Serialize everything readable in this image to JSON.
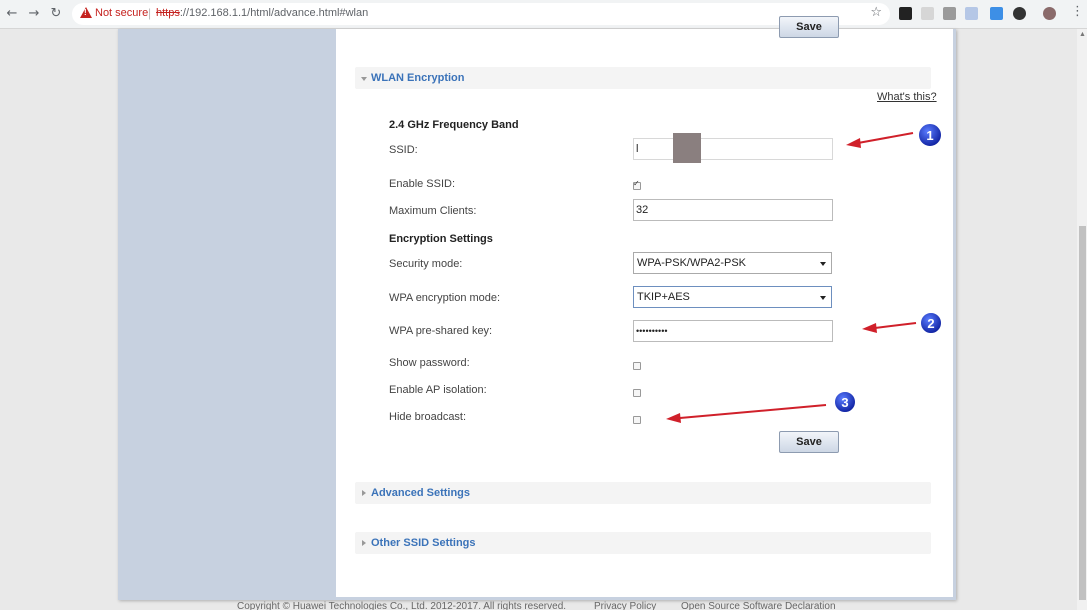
{
  "browser": {
    "back_icon": "arrow-left-icon",
    "forward_icon": "arrow-right-icon",
    "reload_icon": "reload-icon",
    "security_text": "Not secure",
    "url_protocol": "https",
    "url_rest": "://192.168.1.1/html/advance.html#wlan",
    "star_icon": "star-icon",
    "menu_icon": "kebab-menu-icon"
  },
  "top_save_label": "Save",
  "wlan_encryption": {
    "title": "WLAN Encryption",
    "help_link": "What's this?",
    "band_title": "2.4 GHz Frequency Band",
    "ssid": {
      "label": "SSID:",
      "value": "l"
    },
    "enable_ssid": {
      "label": "Enable SSID:",
      "checked": true
    },
    "max_clients": {
      "label": "Maximum Clients:",
      "value": "32"
    },
    "encryption_title": "Encryption Settings",
    "security_mode": {
      "label": "Security mode:",
      "value": "WPA-PSK/WPA2-PSK"
    },
    "wpa_encryption_mode": {
      "label": "WPA encryption mode:",
      "value": "TKIP+AES"
    },
    "wpa_psk": {
      "label": "WPA pre-shared key:",
      "value": "••••••••••"
    },
    "show_password": {
      "label": "Show password:",
      "checked": false
    },
    "ap_isolation": {
      "label": "Enable AP isolation:",
      "checked": false
    },
    "hide_broadcast": {
      "label": "Hide broadcast:",
      "checked": false
    },
    "save_label": "Save"
  },
  "advanced_settings": {
    "title": "Advanced Settings"
  },
  "other_ssid_settings": {
    "title": "Other SSID Settings"
  },
  "annotations": [
    "1",
    "2",
    "3"
  ],
  "footer": {
    "copyright": "Copyright © Huawei Technologies Co., Ltd. 2012-2017. All rights reserved.",
    "privacy": "Privacy Policy",
    "open_source": "Open Source Software Declaration"
  },
  "colors": {
    "link": "#3b73b9",
    "annotation_arrow": "#d0202a",
    "annotation_badge": "#1f3fc7"
  }
}
